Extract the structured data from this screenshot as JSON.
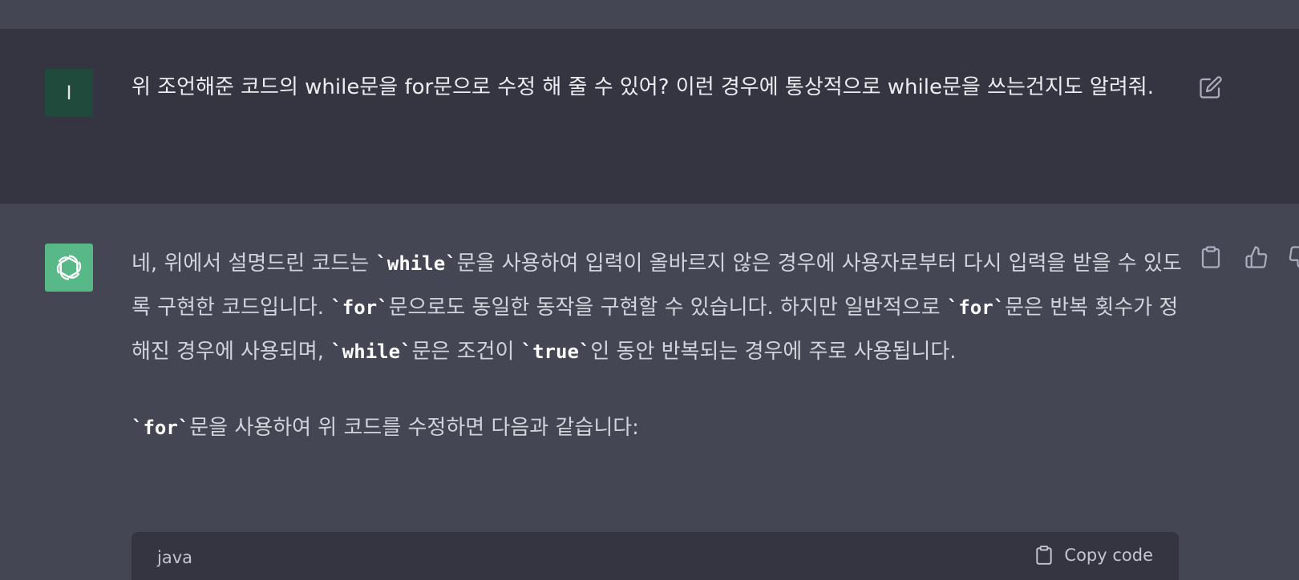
{
  "user_message": {
    "avatar_letter": "I",
    "text": "위 조언해준 코드의 while문을 for문으로 수정 해 줄 수 있어? 이런 경우에 통상적으로 while문을 쓰는건지도 알려줘."
  },
  "assistant_message": {
    "paragraph1": {
      "t1": "네, 위에서 설명드린 코드는 ",
      "c1": "`while`",
      "t2": "문을 사용하여 입력이 올바르지 않은 경우에 사용자로부터 다시 입력을 받을 수 있도록 구현한 코드입니다. ",
      "c2": "`for`",
      "t3": "문으로도 동일한 동작을 구현할 수 있습니다. 하지만 일반적으로 ",
      "c3": "`for`",
      "t4": "문은 반복 횟수가 정해진 경우에 사용되며, ",
      "c4": "`while`",
      "t5": "문은 조건이 ",
      "c5": "`true`",
      "t6": "인 동안 반복되는 경우에 주로 사용됩니다."
    },
    "paragraph2": {
      "c1": "`for`",
      "t1": "문을 사용하여 위 코드를 수정하면 다음과 같습니다:"
    },
    "code_block": {
      "language": "java",
      "copy_label": "Copy code"
    }
  },
  "icons": {
    "edit": "edit-icon",
    "copy": "clipboard-icon",
    "thumbs_up": "thumbs-up-icon",
    "thumbs_down": "thumbs-down-icon",
    "avatar_logo": "openai-logo-icon"
  }
}
